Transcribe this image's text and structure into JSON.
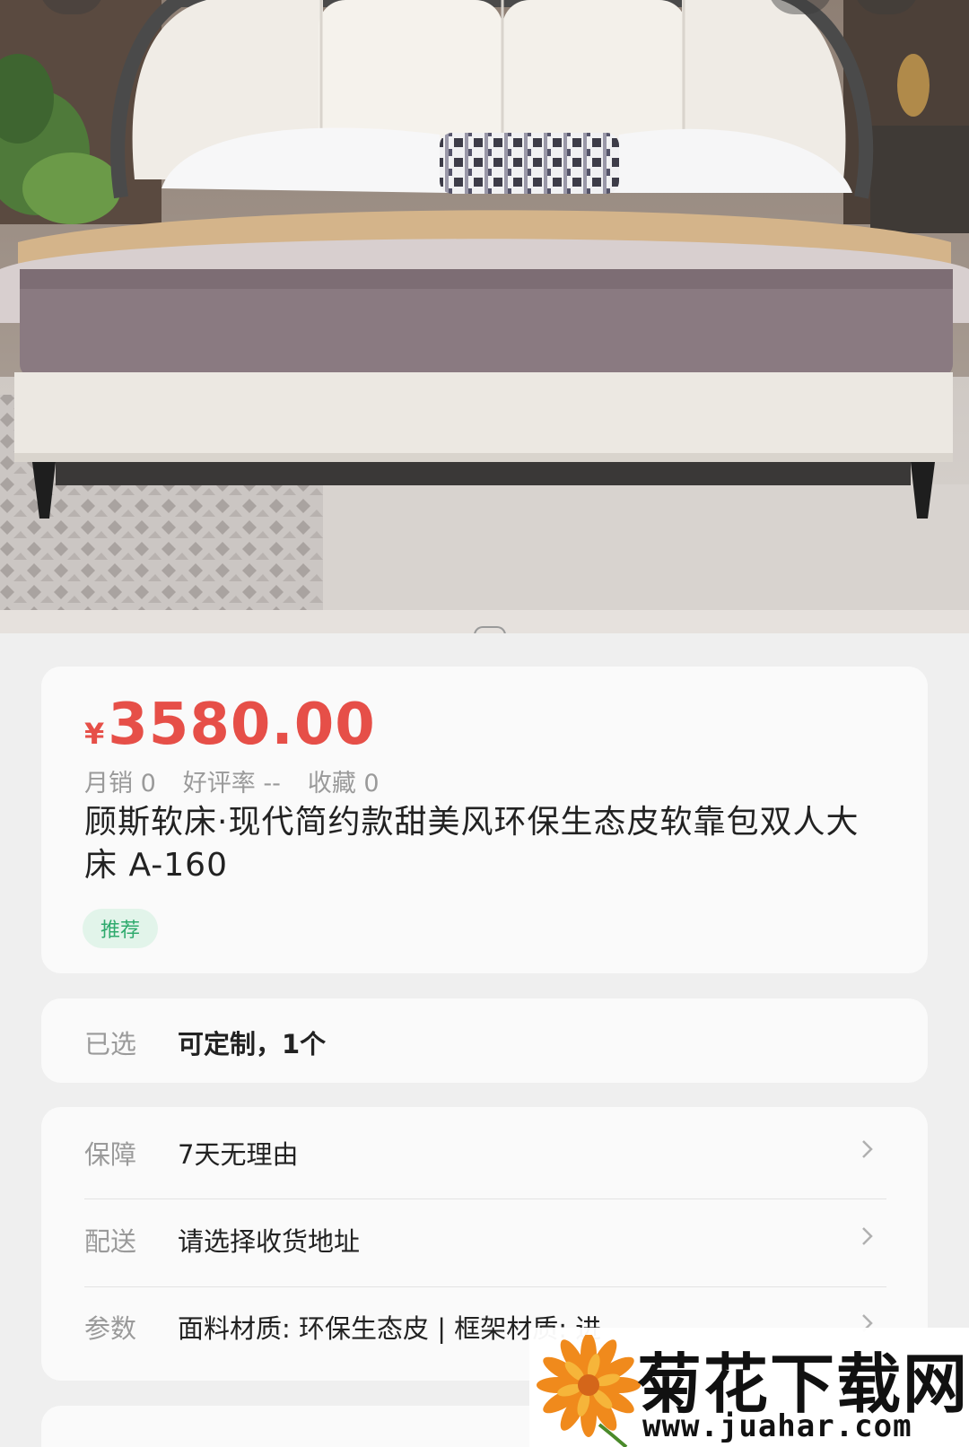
{
  "product": {
    "image_alt": "bed-photo",
    "price_symbol": "¥",
    "price": "3580.00",
    "stats": {
      "monthly_sales": "月销 0",
      "rating": "好评率 --",
      "favorites": "收藏 0"
    },
    "title": "顾斯软床·现代简约款甜美风环保生态皮软靠包双人大床 A-160",
    "tag": "推荐"
  },
  "selected": {
    "label": "已选",
    "value": "可定制，1个"
  },
  "services": [
    {
      "label": "保障",
      "value": "7天无理由",
      "icon": "chevron-right-icon"
    },
    {
      "label": "配送",
      "value": "请选择收货地址",
      "icon": "chevron-right-icon"
    },
    {
      "label": "参数",
      "value": "面料材质: 环保生态皮 | 框架材质: 进",
      "icon": "chevron-right-icon"
    }
  ],
  "watermark": {
    "name": "菊花下载网",
    "url": "www.juahar.com"
  },
  "colors": {
    "price": "#e64f48",
    "tag_bg": "#e2f4ea",
    "tag_text": "#2faa6d",
    "page_bg": "#efefef"
  }
}
